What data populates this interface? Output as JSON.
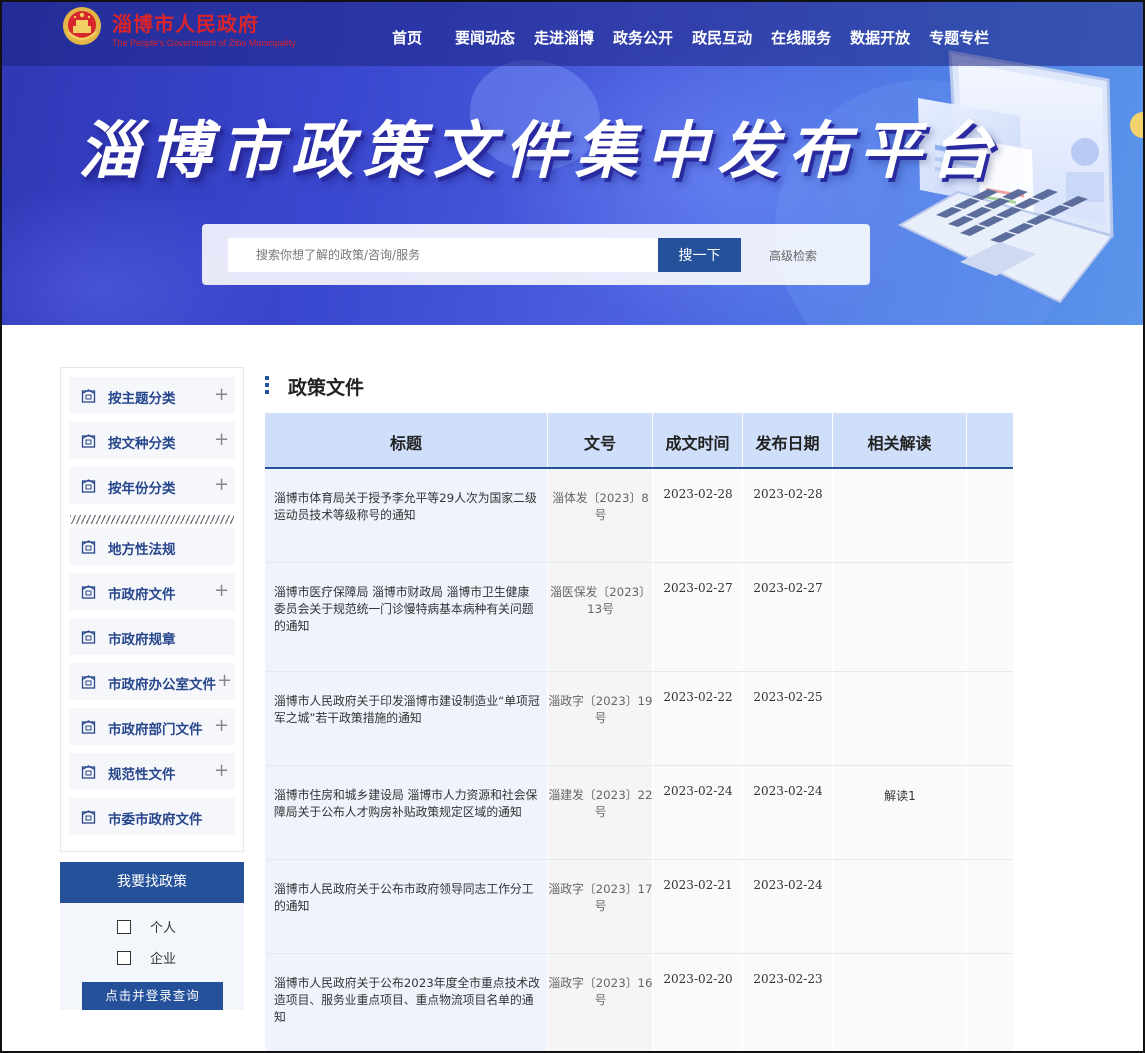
{
  "header": {
    "site_name": "淄博市人民政府",
    "site_name_en": "The People's Government of Zibo Municipality",
    "nav": [
      "首页",
      "要闻动态",
      "走进淄博",
      "政务公开",
      "政民互动",
      "在线服务",
      "数据开放",
      "专题专栏"
    ]
  },
  "hero": {
    "title": "淄博市政策文件集中发布平台",
    "search_placeholder": "搜索你想了解的政策/咨询/服务",
    "search_button": "搜一下",
    "advanced_search": "高级检索"
  },
  "sidebar": {
    "groups": [
      {
        "label": "按主题分类",
        "expand": "+"
      },
      {
        "label": "按文种分类",
        "expand": "+"
      },
      {
        "label": "按年份分类",
        "expand": "+"
      }
    ],
    "items": [
      {
        "label": "地方性法规",
        "expand": ""
      },
      {
        "label": "市政府文件",
        "expand": "+"
      },
      {
        "label": "市政府规章",
        "expand": ""
      },
      {
        "label": "市政府办公室文件",
        "expand": "+"
      },
      {
        "label": "市政府部门文件",
        "expand": "+"
      },
      {
        "label": "规范性文件",
        "expand": "+"
      },
      {
        "label": "市委市政府文件",
        "expand": ""
      }
    ]
  },
  "finder": {
    "header": "我要找政策",
    "options": [
      "个人",
      "企业"
    ],
    "login_button": "点击并登录查询"
  },
  "content": {
    "section_title": "政策文件",
    "columns": [
      "标题",
      "文号",
      "成文时间",
      "发布日期",
      "相关解读",
      ""
    ],
    "rows": [
      {
        "title": "淄博市体育局关于授予李允平等29人次为国家二级运动员技术等级称号的通知",
        "doc_no": "淄体发〔2023〕8号",
        "written": "2023-02-28",
        "published": "2023-02-28",
        "interpretation": ""
      },
      {
        "title": "淄博市医疗保障局 淄博市财政局 淄博市卫生健康委员会关于规范统一门诊慢特病基本病种有关问题的通知",
        "doc_no": "淄医保发〔2023〕13号",
        "written": "2023-02-27",
        "published": "2023-02-27",
        "interpretation": ""
      },
      {
        "title": "淄博市人民政府关于印发淄博市建设制造业“单项冠军之城”若干政策措施的通知",
        "doc_no": "淄政字〔2023〕19号",
        "written": "2023-02-22",
        "published": "2023-02-25",
        "interpretation": ""
      },
      {
        "title": "淄博市住房和城乡建设局 淄博市人力资源和社会保障局关于公布人才购房补贴政策规定区域的通知",
        "doc_no": "淄建发〔2023〕22号",
        "written": "2023-02-24",
        "published": "2023-02-24",
        "interpretation": "解读1"
      },
      {
        "title": "淄博市人民政府关于公布市政府领导同志工作分工的通知",
        "doc_no": "淄政字〔2023〕17号",
        "written": "2023-02-21",
        "published": "2023-02-24",
        "interpretation": ""
      },
      {
        "title": "淄博市人民政府关于公布2023年度全市重点技术改造项目、服务业重点项目、重点物流项目名单的通知",
        "doc_no": "淄政字〔2023〕16号",
        "written": "2023-02-20",
        "published": "2023-02-23",
        "interpretation": ""
      }
    ]
  }
}
